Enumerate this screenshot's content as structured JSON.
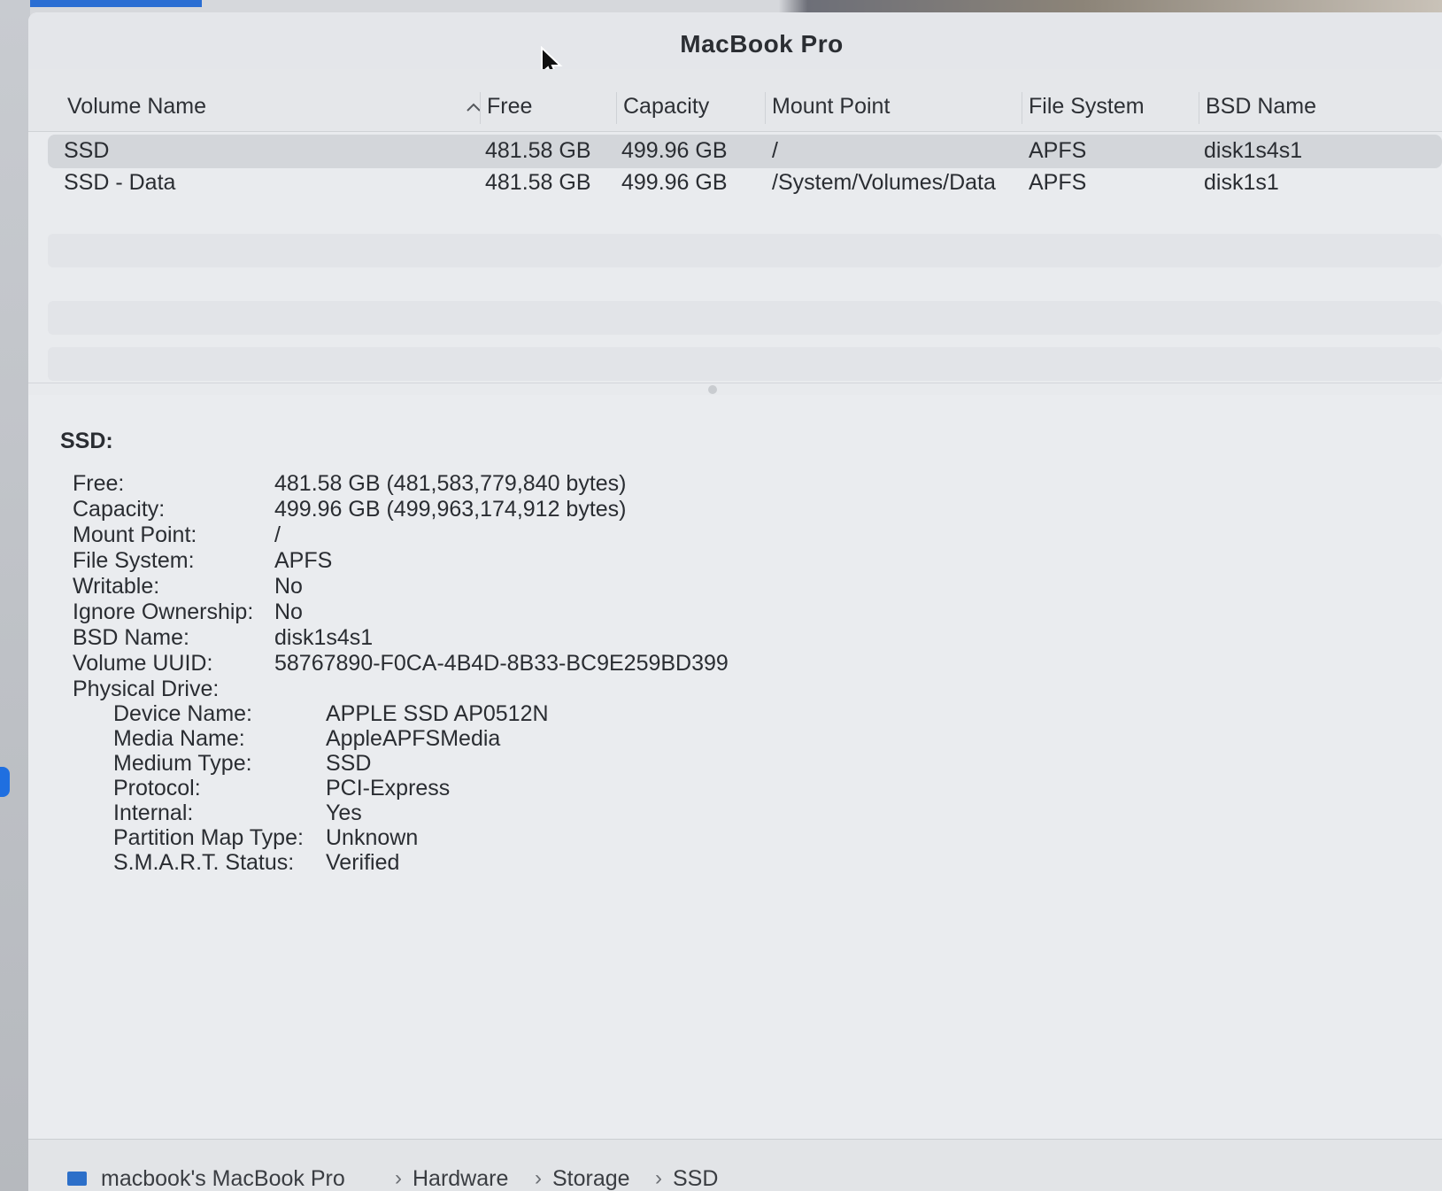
{
  "window": {
    "title": "MacBook Pro"
  },
  "table": {
    "columns": {
      "volume_name": "Volume Name",
      "free": "Free",
      "capacity": "Capacity",
      "mount_point": "Mount Point",
      "file_system": "File System",
      "bsd_name": "BSD Name"
    },
    "rows": [
      {
        "volume_name": "SSD",
        "free": "481.58 GB",
        "capacity": "499.96 GB",
        "mount_point": "/",
        "file_system": "APFS",
        "bsd_name": "disk1s4s1"
      },
      {
        "volume_name": "SSD - Data",
        "free": "481.58 GB",
        "capacity": "499.96 GB",
        "mount_point": "/System/Volumes/Data",
        "file_system": "APFS",
        "bsd_name": "disk1s1"
      }
    ]
  },
  "detail": {
    "title": "SSD:",
    "fields": [
      {
        "label": "Free:",
        "value": "481.58 GB (481,583,779,840 bytes)"
      },
      {
        "label": "Capacity:",
        "value": "499.96 GB (499,963,174,912 bytes)"
      },
      {
        "label": "Mount Point:",
        "value": "/"
      },
      {
        "label": "File System:",
        "value": "APFS"
      },
      {
        "label": "Writable:",
        "value": "No"
      },
      {
        "label": "Ignore Ownership:",
        "value": "No"
      },
      {
        "label": "BSD Name:",
        "value": "disk1s4s1"
      },
      {
        "label": "Volume UUID:",
        "value": "58767890-F0CA-4B4D-8B33-BC9E259BD399"
      },
      {
        "label": "Physical Drive:",
        "value": ""
      }
    ],
    "physical_drive": [
      {
        "label": "Device Name:",
        "value": "APPLE SSD AP0512N"
      },
      {
        "label": "Media Name:",
        "value": "AppleAPFSMedia"
      },
      {
        "label": "Medium Type:",
        "value": "SSD"
      },
      {
        "label": "Protocol:",
        "value": "PCI-Express"
      },
      {
        "label": "Internal:",
        "value": "Yes"
      },
      {
        "label": "Partition Map Type:",
        "value": "Unknown"
      },
      {
        "label": "S.M.A.R.T. Status:",
        "value": "Verified"
      }
    ]
  },
  "pathbar": {
    "items": [
      "macbook's MacBook Pro",
      "Hardware",
      "Storage",
      "SSD"
    ],
    "separator": "›"
  },
  "icons": {
    "sort": "chevron-up-icon",
    "cursor": "mouse-pointer-icon",
    "computer": "computer-icon"
  },
  "colors": {
    "selection": "#d3d6da",
    "accent": "#2c6fc9"
  }
}
